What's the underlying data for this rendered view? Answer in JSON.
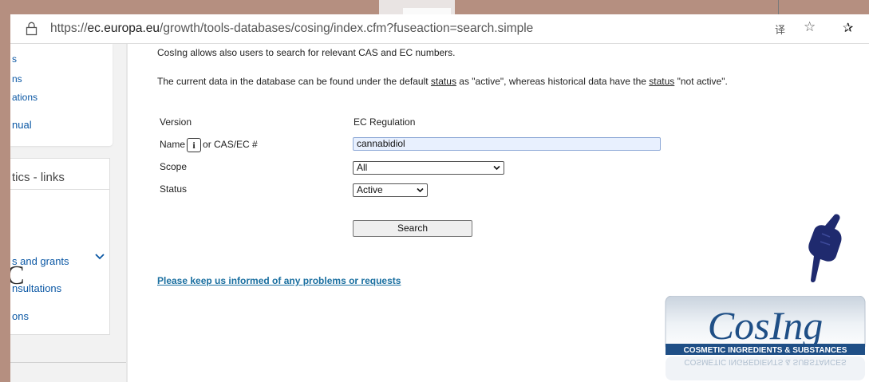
{
  "browser": {
    "url_prefix": "https://",
    "url_domain": "ec.europa.eu",
    "url_path": "/growth/tools-databases/cosing/index.cfm?fuseaction=search.simple",
    "translate_icon_glyph": "译",
    "star_icon_glyph": "☆",
    "favorites_icon_glyph": "✰"
  },
  "sidebar": {
    "box1_links": [
      "s",
      "ns",
      "ations",
      "nual"
    ],
    "box2_title": "tics - links",
    "box2_links": [
      "s and grants",
      "nsultations",
      "ons"
    ],
    "big_letter": "C"
  },
  "main": {
    "intro_line1": "CosIng allows also users to search for relevant CAS and EC numbers.",
    "intro_line2_a": "The current data in the database can be found under the default ",
    "intro_status_word": "status",
    "intro_line2_b": " as \"active\", whereas historical data have the ",
    "intro_line2_c": " \"not active\".",
    "version_label": "Version",
    "version_value": "EC Regulation",
    "name_label": "Name",
    "info_icon_glyph": "i",
    "name_label_suffix": "or CAS/EC #",
    "name_value": "cannabidiol",
    "scope_label": "Scope",
    "scope_value": "All",
    "status_label": "Status",
    "status_value": "Active",
    "search_button": "Search",
    "feedback_link": "Please keep us informed of any problems or requests"
  },
  "logo": {
    "title": "CosIng",
    "subtitle": "COSMETIC INGREDIENTS & SUBSTANCES"
  },
  "colors": {
    "frame": "#b58f80",
    "link": "#0a57a4",
    "hand": "#1f2a6e",
    "logo_text": "#1f4f86"
  }
}
